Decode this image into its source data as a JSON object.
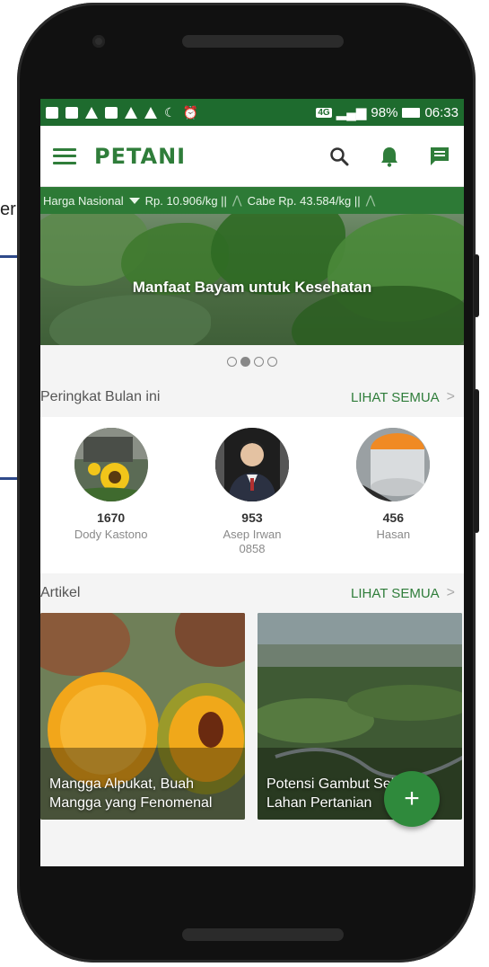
{
  "background": {
    "fragment_text": "er"
  },
  "status_bar": {
    "battery": "98%",
    "time": "06:33",
    "network": "4G"
  },
  "app_bar": {
    "brand": "PETANI"
  },
  "ticker": {
    "label": "Harga Nasional",
    "items": [
      "Rp. 10.906/kg ||",
      "Cabe Rp. 43.584/kg ||"
    ]
  },
  "banner": {
    "title": "Manfaat Bayam untuk Kesehatan",
    "slide_count": 4,
    "active_slide": 2
  },
  "ranking": {
    "title": "Peringkat Bulan ini",
    "see_all": "LIHAT SEMUA",
    "items": [
      {
        "score": "1670",
        "name": "Dody Kastono",
        "avatar_icon": "sunflower-photo"
      },
      {
        "score": "953",
        "name": "Asep Irwan\n0858",
        "avatar_icon": "person-photo"
      },
      {
        "score": "456",
        "name": "Hasan",
        "avatar_icon": "container-photo"
      }
    ]
  },
  "articles": {
    "title": "Artikel",
    "see_all": "LIHAT SEMUA",
    "items": [
      {
        "title": "Mangga Alpukat, Buah Mangga yang Fenomenal"
      },
      {
        "title": "Potensi Gambut Sebagai Lahan Pertanian"
      }
    ]
  },
  "fab": {
    "label": "+"
  },
  "colors": {
    "primary": "#2f7d3a",
    "status_bar": "#1e6b2e",
    "ticker": "#2d7a36"
  }
}
